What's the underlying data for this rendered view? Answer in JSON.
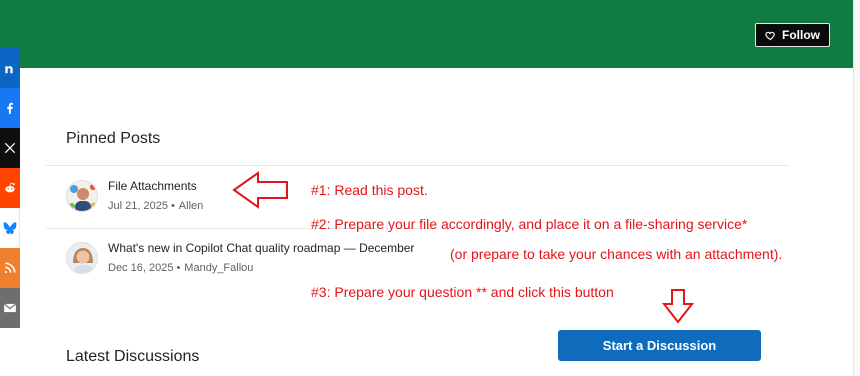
{
  "header": {
    "follow_label": "Follow",
    "accent_color": "#107c41"
  },
  "share": [
    {
      "name": "linkedin-icon",
      "glyph": "in"
    },
    {
      "name": "facebook-icon",
      "glyph": "f"
    },
    {
      "name": "x-icon",
      "glyph": "X"
    },
    {
      "name": "reddit-icon",
      "glyph": ""
    },
    {
      "name": "bluesky-icon",
      "glyph": ""
    },
    {
      "name": "rss-icon",
      "glyph": ""
    },
    {
      "name": "email-icon",
      "glyph": ""
    }
  ],
  "pinned": {
    "title": "Pinned Posts",
    "posts": [
      {
        "title": "File Attachments",
        "date": "Jul 21, 2025",
        "author": "Allen"
      },
      {
        "title": "What's new in Copilot Chat quality roadmap — December",
        "date": "Dec 16, 2025",
        "author": "Mandy_Fallou"
      }
    ]
  },
  "latest": {
    "title": "Latest Discussions"
  },
  "actions": {
    "start_discussion_label": "Start a Discussion",
    "primary_color": "#0f6cbd"
  },
  "annotations": {
    "note1": "#1: Read this post.",
    "note2": "#2: Prepare your file accordingly, and place it on a file-sharing service*",
    "note2b": "(or prepare to take your chances with an attachment).",
    "note3": "#3: Prepare your question ** and click this button",
    "color": "#e3141a"
  }
}
